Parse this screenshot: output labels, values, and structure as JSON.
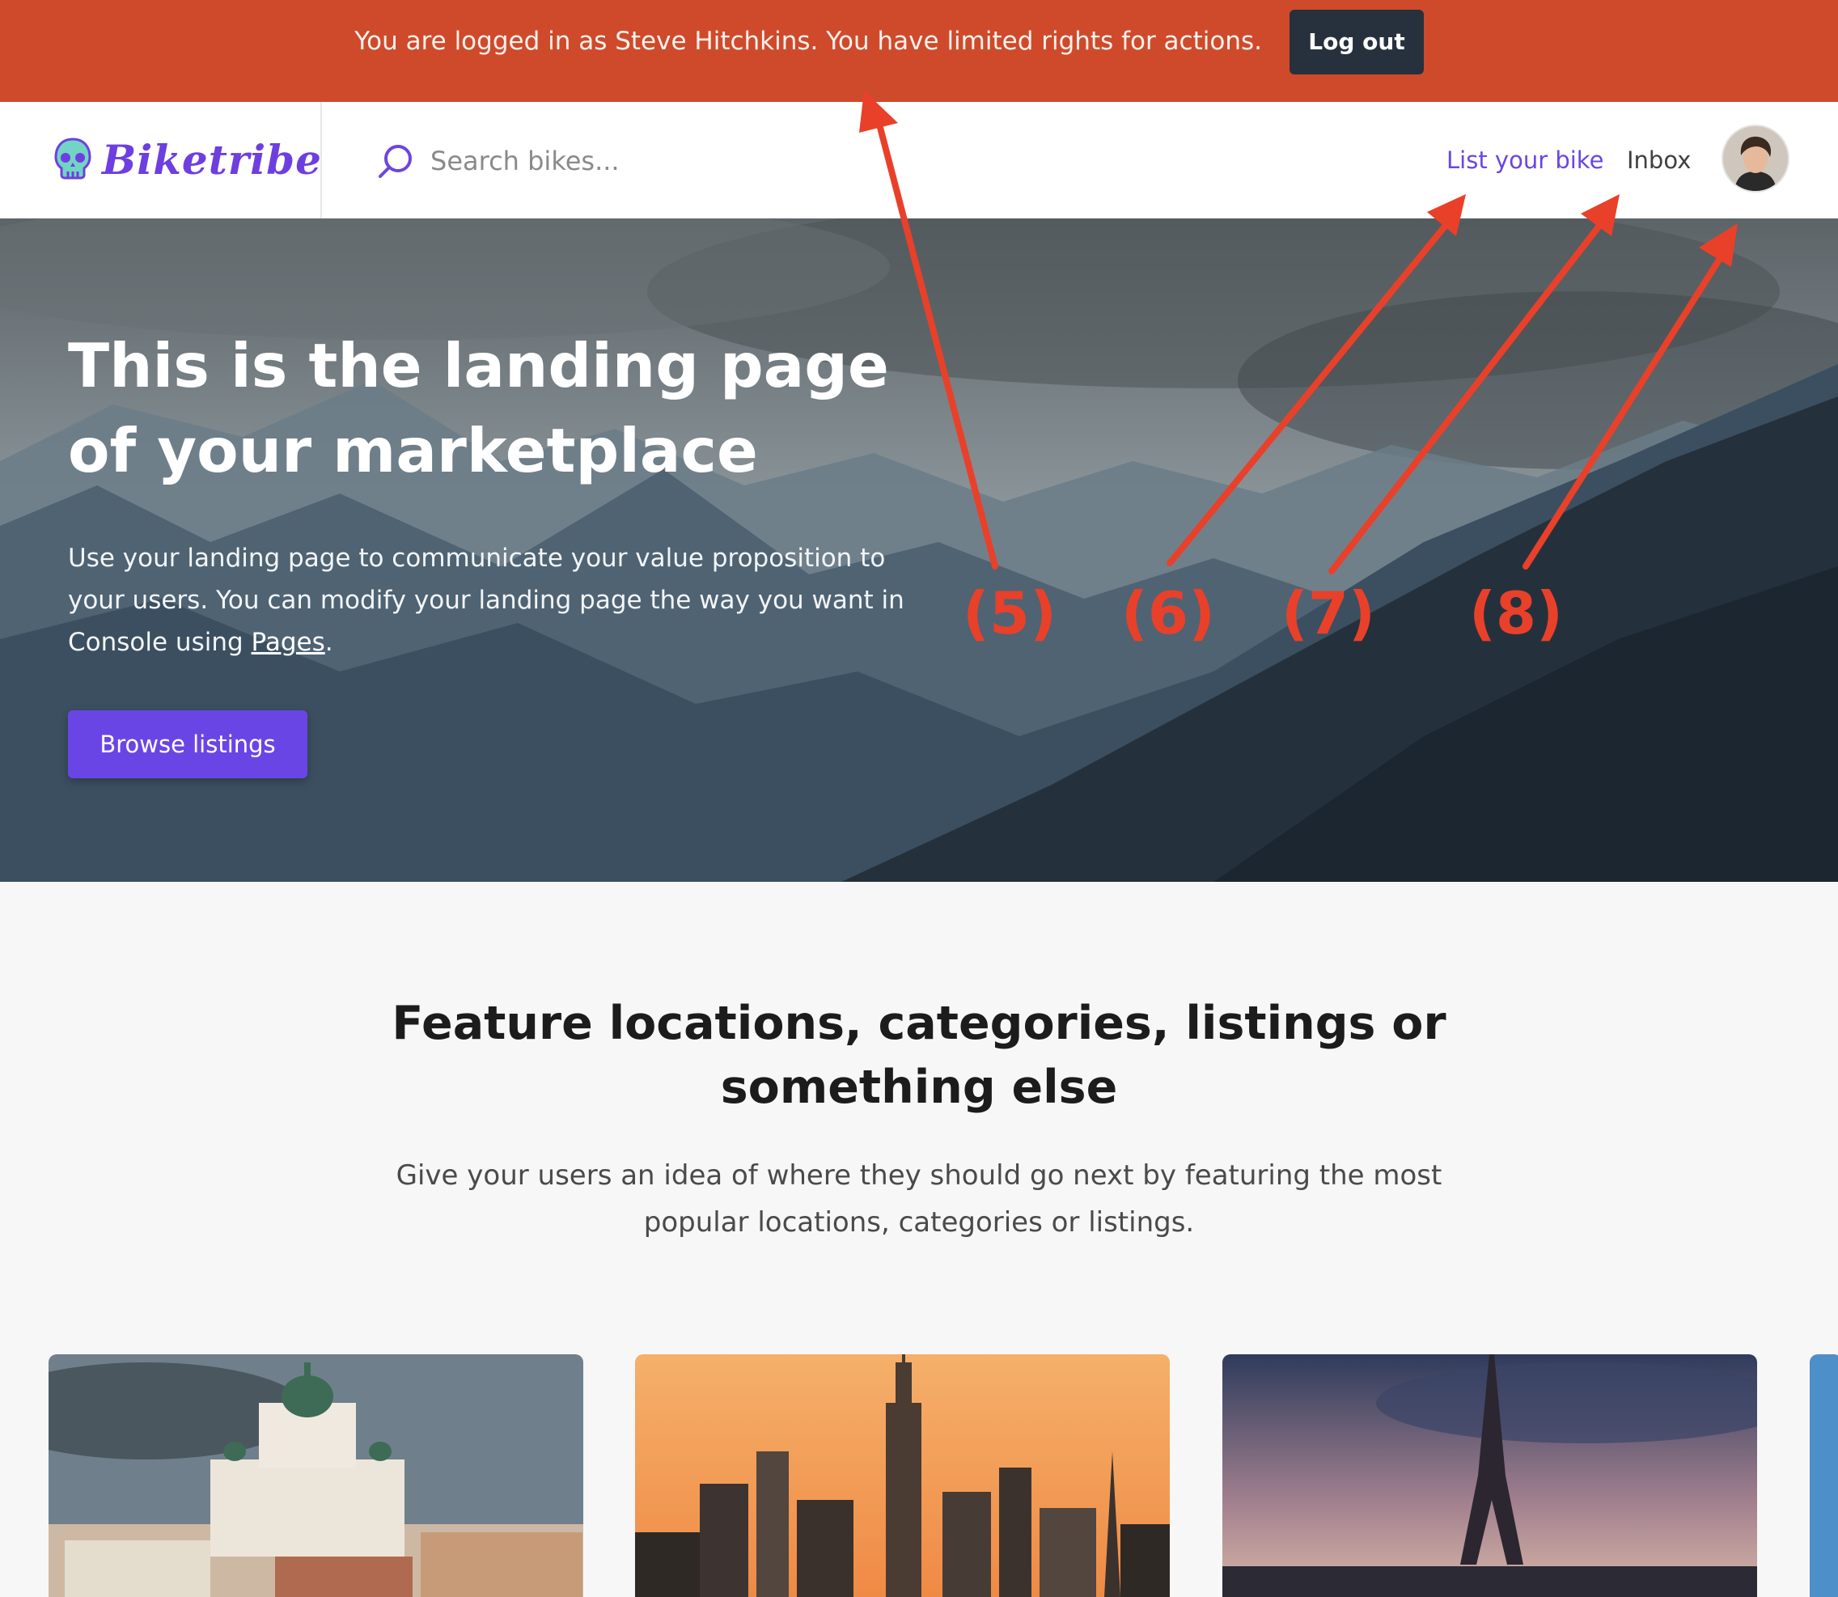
{
  "topbar": {
    "message": "You are logged in as Steve Hitchkins. You have limited rights for actions.",
    "logout_label": "Log out",
    "bg_color": "#cf4a2b"
  },
  "navbar": {
    "logo_text": "Biketribe",
    "logo_icon": "skull-icon",
    "search_icon": "search-icon",
    "search_placeholder": "Search bikes...",
    "list_bike_label": "List your bike",
    "inbox_label": "Inbox",
    "avatar": "user-avatar"
  },
  "hero": {
    "title": "This is the landing page of your marketplace",
    "desc_before": "Use your landing page to communicate your value proposition to your users. You can modify your landing page the way you want in Console using ",
    "desc_link": "Pages",
    "desc_after": ".",
    "cta_label": "Browse listings",
    "accent_color": "#6a45e6"
  },
  "features": {
    "title": "Feature locations, categories, listings or something else",
    "subtitle": "Give your users an idea of where they should go next by featuring the most popular locations, categories or listings."
  },
  "annotations": [
    "(5)",
    "(6)",
    "(7)",
    "(8)"
  ]
}
